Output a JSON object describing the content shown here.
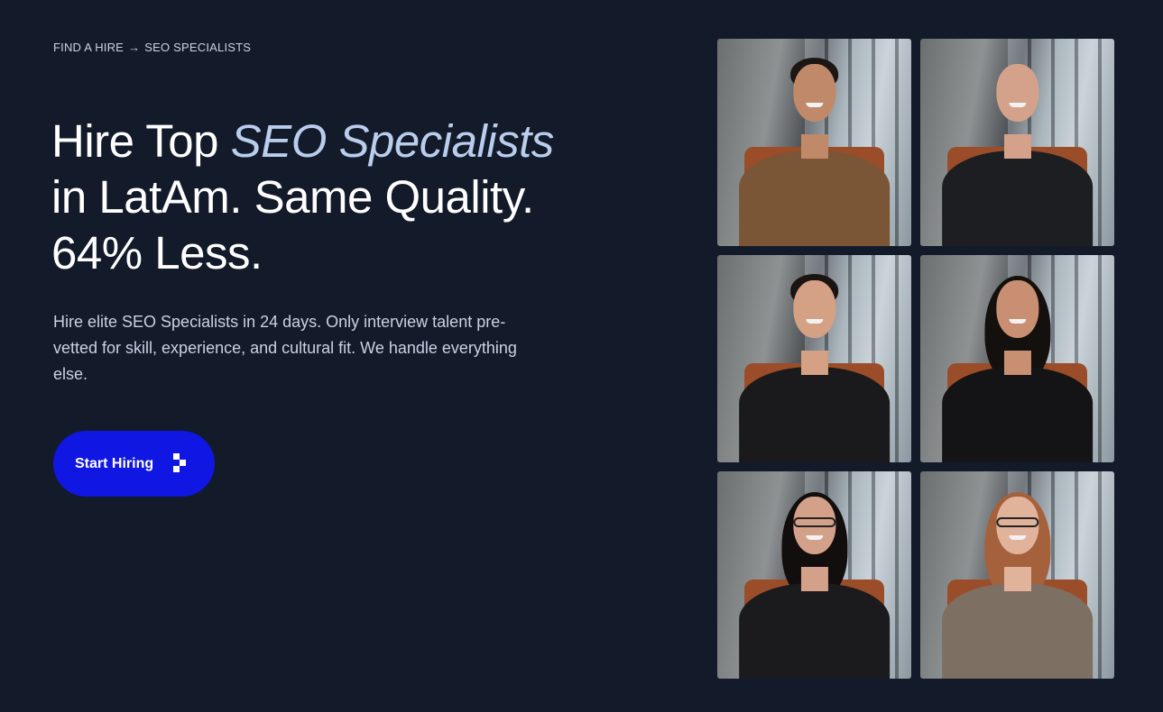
{
  "breadcrumb": {
    "parent": "FIND A HIRE",
    "separator": "→",
    "current": "SEO SPECIALISTS"
  },
  "hero": {
    "title_prefix": "Hire Top ",
    "title_accent": "SEO Specialists",
    "title_line2": "in LatAm. Same Quality.",
    "title_line3": "64% Less.",
    "subtitle": "Hire elite SEO Specialists in 24 days. Only interview talent pre-vetted for skill, experience, and cultural fit. We handle everything else.",
    "cta_label": "Start Hiring",
    "cta_icon": "pixel-arrow-icon"
  },
  "colors": {
    "background": "#131a29",
    "accent_text": "#b9cdec",
    "cta": "#1017e2"
  },
  "photos": [
    {
      "name": "specialist-photo-1",
      "description_icon": "person-photo",
      "outfit": "#7a5536",
      "skin": "#c08a6a",
      "hair": "#1c1714",
      "hair_style": "tied"
    },
    {
      "name": "specialist-photo-2",
      "description_icon": "person-photo",
      "outfit": "#1d1e22",
      "skin": "#d4a28a",
      "hair": "#c79c85",
      "hair_style": "bald"
    },
    {
      "name": "specialist-photo-3",
      "description_icon": "person-photo",
      "outfit": "#1a1a1c",
      "skin": "#d4a184",
      "hair": "#1a1412",
      "hair_style": "short"
    },
    {
      "name": "specialist-photo-4",
      "description_icon": "person-photo",
      "outfit": "#141416",
      "skin": "#c98f72",
      "hair": "#14100e",
      "hair_style": "long"
    },
    {
      "name": "specialist-photo-5",
      "description_icon": "person-photo",
      "outfit": "#1b1b1d",
      "skin": "#d3a08a",
      "hair": "#120e0d",
      "hair_style": "long",
      "glasses": true
    },
    {
      "name": "specialist-photo-6",
      "description_icon": "person-photo",
      "outfit": "#7d6f62",
      "skin": "#e2b39b",
      "hair": "#a5603c",
      "hair_style": "long",
      "glasses": true
    }
  ]
}
